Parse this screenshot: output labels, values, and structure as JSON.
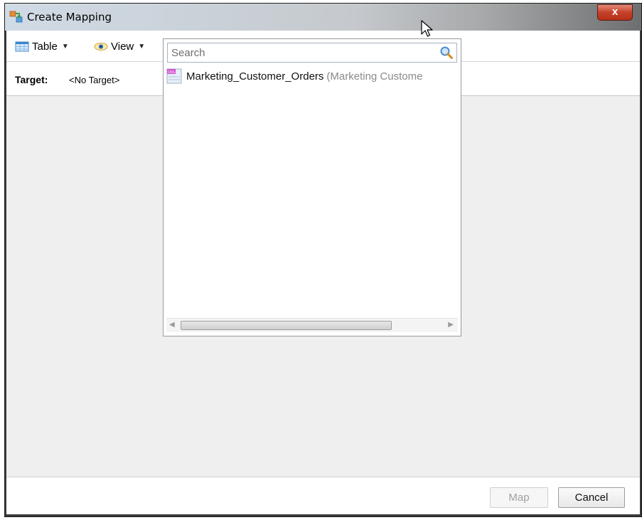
{
  "window": {
    "title": "Create Mapping",
    "close_label": "x"
  },
  "toolbar": {
    "table_label": "Table",
    "view_label": "View"
  },
  "target": {
    "label": "Target:",
    "value": "<No Target>"
  },
  "popup": {
    "search_placeholder": "Search",
    "results": [
      {
        "name": "Marketing_Customer_Orders",
        "description": "(Marketing Custome",
        "icon": "ddl-icon"
      }
    ]
  },
  "footer": {
    "map_label": "Map",
    "cancel_label": "Cancel"
  },
  "colors": {
    "close_button": "#c4412b",
    "main_background": "#efefef",
    "disabled_text": "#a0a0a0"
  }
}
